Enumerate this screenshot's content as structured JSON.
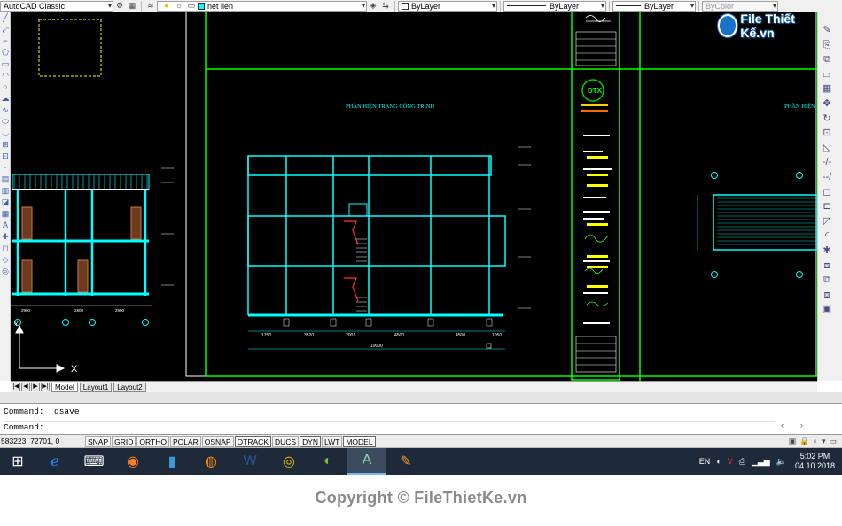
{
  "toolbar": {
    "workspace": "AutoCAD Classic",
    "layer": "net lien",
    "color": "ByLayer",
    "linetype": "ByLayer",
    "lineweight": "ByLayer",
    "plotstyle": "ByColor"
  },
  "watermark_logo": "File Thiết Kế.vn",
  "drawing": {
    "title_main": "PHẦN HIỆN TRẠNG CÔNG TRÌNH",
    "title_right": "PHẦN HIỆN",
    "left_dims": [
      "2900",
      "2800",
      "2900"
    ],
    "elev_dims": [
      "1750",
      "3520",
      "2001",
      "4500",
      "4500",
      "1050"
    ],
    "elev_total": "19000",
    "stamp": "DTX"
  },
  "tabs": [
    "Model",
    "Layout1",
    "Layout2"
  ],
  "command": {
    "history": "Command: _qsave",
    "prompt": "Command:"
  },
  "status": {
    "coords": "583223, 72701, 0",
    "buttons": [
      "SNAP",
      "GRID",
      "ORTHO",
      "POLAR",
      "OSNAP",
      "OTRACK",
      "DUCS",
      "DYN",
      "LWT",
      "MODEL"
    ]
  },
  "taskbar": {
    "lang": "EN",
    "time": "5:02 PM",
    "date": "04.10.2018"
  },
  "copyright": "Copyright © FileThietKe.vn",
  "colors": {
    "canvas": "#000000",
    "cyan": "#00ffff",
    "green": "#00ff00",
    "taskbar": "#1e2a39"
  }
}
